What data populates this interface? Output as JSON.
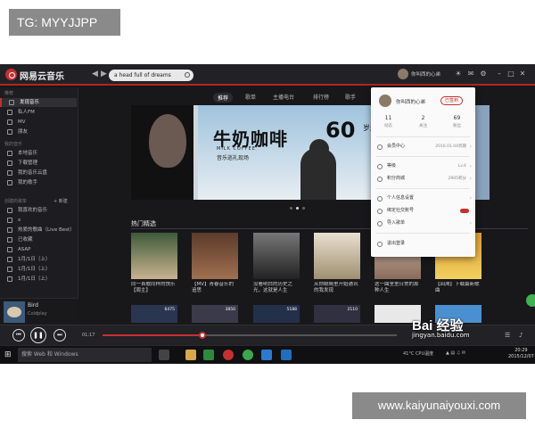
{
  "watermark_top": "TG: MYYJJPP",
  "watermark_bottom": "www.kaiyunaiyouxi.com",
  "app": {
    "title": "网易云音乐",
    "search_value": "a head full of dreams",
    "user_name": "你叫西的心弟",
    "accent": "#c62f2f"
  },
  "tabs": [
    "推荐",
    "歌单",
    "主播电台",
    "排行榜",
    "歌手"
  ],
  "sidebar": {
    "recommend_head": "推荐",
    "items_top": [
      "发现音乐",
      "私人FM",
      "MV",
      "朋友"
    ],
    "my_music_head": "我的音乐",
    "items_mid": [
      "本地音乐",
      "下载管理",
      "我的音乐云盘",
      "我的歌手"
    ],
    "playlist_head": "创建的歌单",
    "add_label": "+ 新建",
    "items_playlists": [
      "我喜欢的音乐",
      "x",
      "热爱的歌曲（Live Best）",
      "已收藏",
      "ASAP",
      "1月/1日（上）",
      "1月/1日（上）",
      "1月/1日（上）"
    ],
    "mini_title": "Bird",
    "mini_artist": "Coldplay"
  },
  "banner": {
    "big_text": "牛奶咖啡",
    "brand_text": "MILK COFFEE",
    "sub_text": "音乐巡礼现场",
    "number": "60",
    "sub2": "岁还要听"
  },
  "section_title": "热门精选",
  "cards": [
    {
      "caption": "同一首歌同样的快乐【周主】"
    },
    {
      "caption": "【MV】青春音乐的追思"
    },
    {
      "caption": "没看明白的历史之光，这就是人生"
    },
    {
      "caption": "从你眼睛里开始通讯的我发现"
    },
    {
      "caption": "这一曲里里日常的那种人生"
    },
    {
      "caption": "【回溯】下载最新歌曲"
    }
  ],
  "cards_row2": [
    "6475",
    "3850",
    "5188",
    "2110",
    "",
    ""
  ],
  "popup": {
    "name": "你叫西的心弟",
    "sign_label": "已签到",
    "stats": [
      {
        "value": "11",
        "label": "动态"
      },
      {
        "value": "2",
        "label": "关注"
      },
      {
        "value": "69",
        "label": "粉丝"
      }
    ],
    "items": [
      {
        "label": "会员中心",
        "value": "2016.01.04到期"
      },
      {
        "label": "等级",
        "value": "Lv.6"
      },
      {
        "label": "积分商城",
        "value": "2905积分"
      },
      {
        "label": "个人信息设置",
        "value": ""
      },
      {
        "label": "绑定社交账号",
        "value": ""
      },
      {
        "label": "导入歌单",
        "value": ""
      },
      {
        "label": "退出登录",
        "value": ""
      }
    ]
  },
  "player": {
    "time_elapsed": "01:17",
    "progress": 0.34
  },
  "baidu": {
    "logo": "Bai 经验",
    "url": "jingyan.baidu.com"
  },
  "taskbar": {
    "search_placeholder": "搜索 Web 和 Windows",
    "cpu_label": "41°C CPU温度",
    "time": "20:29",
    "date": "2015/12/07"
  }
}
